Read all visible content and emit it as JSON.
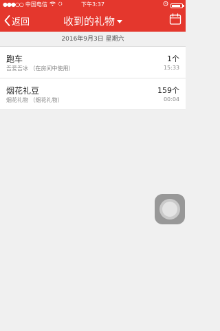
{
  "status": {
    "signal": "●●●○○",
    "carrier": "中国电信",
    "wifi": "wifi-icon",
    "time": "下午3:37",
    "alarm": "alarm-icon",
    "battery": "battery-icon"
  },
  "nav": {
    "back_label": "返回",
    "title": "收到的礼物"
  },
  "date_header": "2016年9月3日 星期六",
  "gifts": [
    {
      "name": "跑车",
      "desc": "吾爱吾冰 （在房间中使用）",
      "count": "1个",
      "time": "15:33"
    },
    {
      "name": "烟花礼豆",
      "desc": "烟花礼物 （烟花礼物）",
      "count": "159个",
      "time": "00:04"
    }
  ],
  "colors": {
    "accent": "#e4372d",
    "background": "#f0f0f0"
  }
}
